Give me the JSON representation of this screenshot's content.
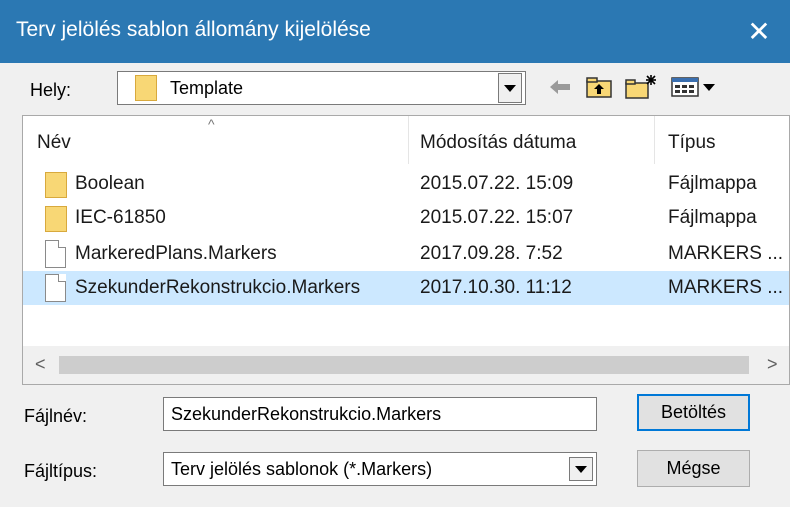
{
  "window": {
    "title": "Terv jelölés sablon állomány kijelölése",
    "close_glyph": "✕"
  },
  "lookin": {
    "label": "Hely:",
    "value": "Template"
  },
  "toolbar": {
    "back_icon": "back-arrow-icon",
    "up_icon": "up-folder-icon",
    "new_folder_icon": "new-folder-icon",
    "view_icon": "view-menu-icon"
  },
  "list": {
    "columns": {
      "name": "Név",
      "date": "Módosítás dátuma",
      "type": "Típus"
    },
    "rows": [
      {
        "name": "Boolean",
        "date": "2015.07.22. 15:09",
        "type": "Fájlmappa",
        "icon": "folder-icon",
        "selected": false
      },
      {
        "name": "IEC-61850",
        "date": "2015.07.22. 15:07",
        "type": "Fájlmappa",
        "icon": "folder-icon",
        "selected": false
      },
      {
        "name": "MarkeredPlans.Markers",
        "date": "2017.09.28. 7:52",
        "type": "MARKERS ...",
        "icon": "file-icon",
        "selected": false
      },
      {
        "name": "SzekunderRekonstrukcio.Markers",
        "date": "2017.10.30. 11:12",
        "type": "MARKERS ...",
        "icon": "file-icon",
        "selected": true
      }
    ],
    "scroll_left": "<",
    "scroll_right": ">"
  },
  "filename": {
    "label": "Fájlnév:",
    "value": "SzekunderRekonstrukcio.Markers"
  },
  "filetype": {
    "label": "Fájltípus:",
    "value": "Terv jelölés sablonok (*.Markers)"
  },
  "buttons": {
    "load": "Betöltés",
    "cancel": "Mégse"
  },
  "colors": {
    "titlebar": "#2b78b3",
    "selection": "#cce8ff",
    "default_button_border": "#0078d7"
  }
}
